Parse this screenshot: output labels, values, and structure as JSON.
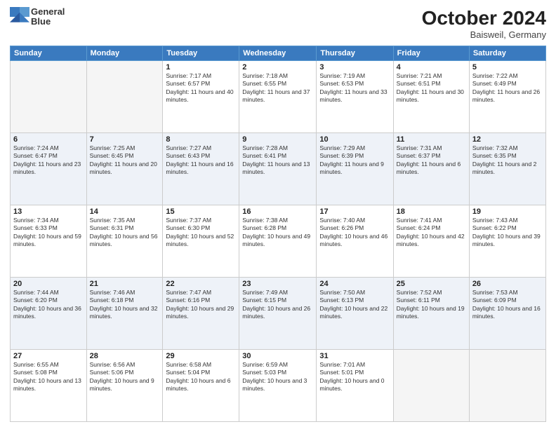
{
  "header": {
    "logo": {
      "line1": "General",
      "line2": "Blue"
    },
    "month_year": "October 2024",
    "location": "Baisweil, Germany"
  },
  "days_of_week": [
    "Sunday",
    "Monday",
    "Tuesday",
    "Wednesday",
    "Thursday",
    "Friday",
    "Saturday"
  ],
  "weeks": [
    [
      {
        "day": "",
        "info": ""
      },
      {
        "day": "",
        "info": ""
      },
      {
        "day": "1",
        "info": "Sunrise: 7:17 AM\nSunset: 6:57 PM\nDaylight: 11 hours and 40 minutes."
      },
      {
        "day": "2",
        "info": "Sunrise: 7:18 AM\nSunset: 6:55 PM\nDaylight: 11 hours and 37 minutes."
      },
      {
        "day": "3",
        "info": "Sunrise: 7:19 AM\nSunset: 6:53 PM\nDaylight: 11 hours and 33 minutes."
      },
      {
        "day": "4",
        "info": "Sunrise: 7:21 AM\nSunset: 6:51 PM\nDaylight: 11 hours and 30 minutes."
      },
      {
        "day": "5",
        "info": "Sunrise: 7:22 AM\nSunset: 6:49 PM\nDaylight: 11 hours and 26 minutes."
      }
    ],
    [
      {
        "day": "6",
        "info": "Sunrise: 7:24 AM\nSunset: 6:47 PM\nDaylight: 11 hours and 23 minutes."
      },
      {
        "day": "7",
        "info": "Sunrise: 7:25 AM\nSunset: 6:45 PM\nDaylight: 11 hours and 20 minutes."
      },
      {
        "day": "8",
        "info": "Sunrise: 7:27 AM\nSunset: 6:43 PM\nDaylight: 11 hours and 16 minutes."
      },
      {
        "day": "9",
        "info": "Sunrise: 7:28 AM\nSunset: 6:41 PM\nDaylight: 11 hours and 13 minutes."
      },
      {
        "day": "10",
        "info": "Sunrise: 7:29 AM\nSunset: 6:39 PM\nDaylight: 11 hours and 9 minutes."
      },
      {
        "day": "11",
        "info": "Sunrise: 7:31 AM\nSunset: 6:37 PM\nDaylight: 11 hours and 6 minutes."
      },
      {
        "day": "12",
        "info": "Sunrise: 7:32 AM\nSunset: 6:35 PM\nDaylight: 11 hours and 2 minutes."
      }
    ],
    [
      {
        "day": "13",
        "info": "Sunrise: 7:34 AM\nSunset: 6:33 PM\nDaylight: 10 hours and 59 minutes."
      },
      {
        "day": "14",
        "info": "Sunrise: 7:35 AM\nSunset: 6:31 PM\nDaylight: 10 hours and 56 minutes."
      },
      {
        "day": "15",
        "info": "Sunrise: 7:37 AM\nSunset: 6:30 PM\nDaylight: 10 hours and 52 minutes."
      },
      {
        "day": "16",
        "info": "Sunrise: 7:38 AM\nSunset: 6:28 PM\nDaylight: 10 hours and 49 minutes."
      },
      {
        "day": "17",
        "info": "Sunrise: 7:40 AM\nSunset: 6:26 PM\nDaylight: 10 hours and 46 minutes."
      },
      {
        "day": "18",
        "info": "Sunrise: 7:41 AM\nSunset: 6:24 PM\nDaylight: 10 hours and 42 minutes."
      },
      {
        "day": "19",
        "info": "Sunrise: 7:43 AM\nSunset: 6:22 PM\nDaylight: 10 hours and 39 minutes."
      }
    ],
    [
      {
        "day": "20",
        "info": "Sunrise: 7:44 AM\nSunset: 6:20 PM\nDaylight: 10 hours and 36 minutes."
      },
      {
        "day": "21",
        "info": "Sunrise: 7:46 AM\nSunset: 6:18 PM\nDaylight: 10 hours and 32 minutes."
      },
      {
        "day": "22",
        "info": "Sunrise: 7:47 AM\nSunset: 6:16 PM\nDaylight: 10 hours and 29 minutes."
      },
      {
        "day": "23",
        "info": "Sunrise: 7:49 AM\nSunset: 6:15 PM\nDaylight: 10 hours and 26 minutes."
      },
      {
        "day": "24",
        "info": "Sunrise: 7:50 AM\nSunset: 6:13 PM\nDaylight: 10 hours and 22 minutes."
      },
      {
        "day": "25",
        "info": "Sunrise: 7:52 AM\nSunset: 6:11 PM\nDaylight: 10 hours and 19 minutes."
      },
      {
        "day": "26",
        "info": "Sunrise: 7:53 AM\nSunset: 6:09 PM\nDaylight: 10 hours and 16 minutes."
      }
    ],
    [
      {
        "day": "27",
        "info": "Sunrise: 6:55 AM\nSunset: 5:08 PM\nDaylight: 10 hours and 13 minutes."
      },
      {
        "day": "28",
        "info": "Sunrise: 6:56 AM\nSunset: 5:06 PM\nDaylight: 10 hours and 9 minutes."
      },
      {
        "day": "29",
        "info": "Sunrise: 6:58 AM\nSunset: 5:04 PM\nDaylight: 10 hours and 6 minutes."
      },
      {
        "day": "30",
        "info": "Sunrise: 6:59 AM\nSunset: 5:03 PM\nDaylight: 10 hours and 3 minutes."
      },
      {
        "day": "31",
        "info": "Sunrise: 7:01 AM\nSunset: 5:01 PM\nDaylight: 10 hours and 0 minutes."
      },
      {
        "day": "",
        "info": ""
      },
      {
        "day": "",
        "info": ""
      }
    ]
  ]
}
